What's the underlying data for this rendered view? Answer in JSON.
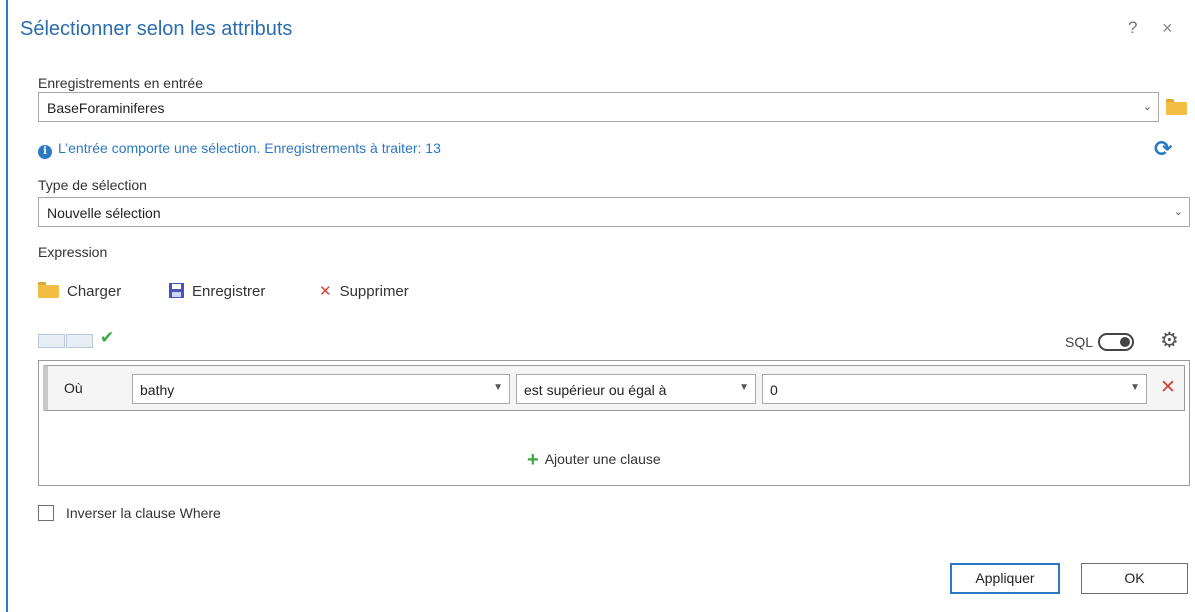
{
  "dialog": {
    "title": "Sélectionner selon les attributs",
    "help": "?",
    "close": "×"
  },
  "input_records": {
    "label": "Enregistrements en entrée",
    "value": "BaseForaminiferes"
  },
  "info": {
    "text": "L’entrée comporte une sélection. Enregistrements à traiter: 13",
    "icon_glyph": "i"
  },
  "selection_type": {
    "label": "Type de sélection",
    "value": "Nouvelle sélection"
  },
  "expression": {
    "label": "Expression",
    "load_label": "Charger",
    "save_label": "Enregistrer",
    "delete_label": "Supprimer",
    "sql_label": "SQL",
    "sql_enabled": false
  },
  "clause": {
    "where_label": "Où",
    "field": "bathy",
    "operator": "est supérieur ou égal à",
    "value": "0",
    "add_clause_label": "Ajouter une clause"
  },
  "invert": {
    "label": "Inverser la clause Where",
    "checked": false
  },
  "buttons": {
    "apply": "Appliquer",
    "ok": "OK"
  },
  "colors": {
    "accent": "#2b78c5",
    "folder": "#f3be43",
    "delete": "#d0463a",
    "success": "#3da83d"
  },
  "icons": {
    "dropdown": "⌄",
    "check": "✔",
    "gear": "⚙",
    "refresh": "⟳",
    "delete": "✕",
    "plus": "+"
  }
}
